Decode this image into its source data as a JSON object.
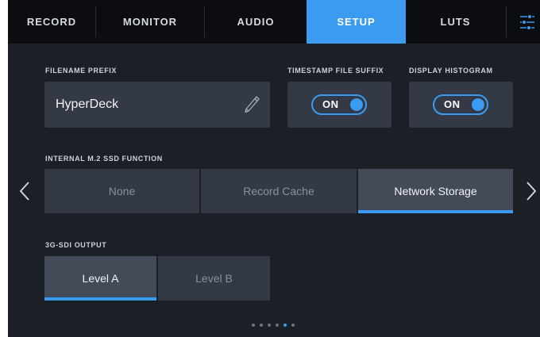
{
  "tabs": [
    {
      "label": "RECORD"
    },
    {
      "label": "MONITOR"
    },
    {
      "label": "AUDIO"
    },
    {
      "label": "SETUP"
    },
    {
      "label": "LUTS"
    }
  ],
  "active_tab": "SETUP",
  "filename": {
    "label": "FILENAME PREFIX",
    "value": "HyperDeck",
    "edit_icon": "pencil-icon"
  },
  "timestamp_suffix": {
    "label": "TIMESTAMP FILE SUFFIX",
    "state": "ON"
  },
  "histogram": {
    "label": "DISPLAY HISTOGRAM",
    "state": "ON"
  },
  "ssd_function": {
    "label": "INTERNAL M.2 SSD FUNCTION",
    "options": [
      "None",
      "Record Cache",
      "Network Storage"
    ],
    "selected": "Network Storage"
  },
  "sdi_output": {
    "label": "3G-SDI OUTPUT",
    "options": [
      "Level A",
      "Level B"
    ],
    "selected": "Level A"
  },
  "pagination": {
    "total": 6,
    "current": 5
  },
  "colors": {
    "accent": "#3a9bf0",
    "background": "#1b1f26",
    "panel": "#333a45",
    "tabbar": "#0c0d10"
  }
}
